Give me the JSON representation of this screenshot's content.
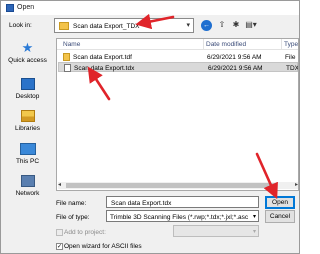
{
  "titlebar": {
    "title": "Open"
  },
  "toolbar": {
    "look_in_label": "Look in:",
    "look_in_value": "Scan data Export_TDX"
  },
  "places": [
    {
      "label": "Quick access",
      "icon": "star-icon"
    },
    {
      "label": "Desktop",
      "icon": "desktop-icon"
    },
    {
      "label": "Libraries",
      "icon": "libraries-icon"
    },
    {
      "label": "This PC",
      "icon": "computer-icon"
    },
    {
      "label": "Network",
      "icon": "network-icon"
    }
  ],
  "filelist": {
    "columns": [
      "Name",
      "Date modified",
      "Type"
    ],
    "rows": [
      {
        "name": "Scan data Export.tdf",
        "date": "6/29/2021 9:56 AM",
        "type": "File",
        "icon": "folder-icon",
        "selected": false
      },
      {
        "name": "Scan data Export.tdx",
        "date": "6/29/2021 9:56 AM",
        "type": "TDX",
        "icon": "document-icon",
        "selected": true
      }
    ]
  },
  "form": {
    "file_name_label": "File name:",
    "file_name_value": "Scan data Export.tdx",
    "file_type_label": "File of type:",
    "file_type_value": "Trimble 3D Scanning Files (*.rwp;*.tdx;*.jxl;*.asc",
    "add_project_label": "Add to project:",
    "wizard_label": "Open wizard for ASCII files",
    "wizard_checked": true,
    "add_project_checked": false
  },
  "buttons": {
    "open": "Open",
    "cancel": "Cancel"
  },
  "colors": {
    "annotation_arrow": "#e0242a",
    "selection": "#d9d9d9",
    "accent": "#0078d7"
  }
}
